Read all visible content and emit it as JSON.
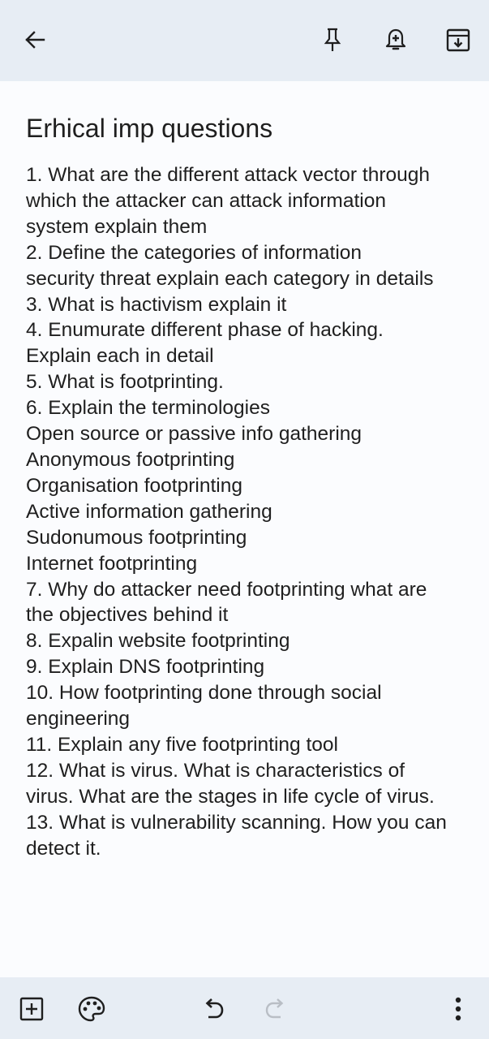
{
  "toolbar": {
    "back_icon": "arrow-left-icon",
    "pin_icon": "pin-icon",
    "reminder_icon": "bell-plus-icon",
    "archive_icon": "archive-icon"
  },
  "note": {
    "title": "Erhical imp questions",
    "lines": [
      "1. What are the different attack vector through",
      "which the attacker can attack information",
      "system  explain them",
      "2. Define the categories of information",
      "security threat explain each category in details",
      "3. What is hactivism explain it",
      "4. Enumurate different phase of hacking.",
      "Explain each in detail",
      "5. What is footprinting.",
      "6. Explain the terminologies",
      "Open source or passive info gathering",
      "Anonymous footprinting",
      "Organisation footprinting",
      "Active information gathering",
      "Sudonumous footprinting",
      "Internet footprinting",
      "7. Why do attacker need footprinting what are",
      "the objectives behind it",
      "8. Expalin website footprinting",
      "9. Explain DNS footprinting",
      "10. How footprinting done through social",
      "engineering",
      "11. Explain any five footprinting tool",
      "12. What is virus. What is characteristics of",
      "virus. What are the stages in life cycle of virus.",
      "13. What is vulnerability scanning. How you can",
      "detect it."
    ]
  },
  "bottom_bar": {
    "add_icon": "add-box-icon",
    "palette_icon": "palette-icon",
    "undo_icon": "undo-icon",
    "redo_icon": "redo-icon",
    "more_icon": "more-vert-icon"
  },
  "colors": {
    "bar_background": "#e7edf4",
    "page_background": "#fbfcfe",
    "text": "#1f1f1f",
    "disabled_icon": "#b9bec5"
  }
}
